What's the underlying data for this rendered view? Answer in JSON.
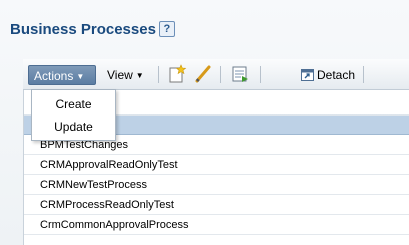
{
  "header": {
    "title": "Business Processes",
    "help_glyph": "?"
  },
  "toolbar": {
    "actions_label": "Actions",
    "view_label": "View",
    "detach_label": "Detach",
    "accent_color": "#5b7da3"
  },
  "actions_menu": {
    "items": [
      "Create",
      "Update"
    ]
  },
  "table": {
    "rows": [
      "",
      "BPMTestChanges",
      "CRMApprovalReadOnlyTest",
      "CRMNewTestProcess",
      "CRMProcessReadOnlyTest",
      "CrmCommonApprovalProcess"
    ],
    "selected_row_index": 0
  }
}
